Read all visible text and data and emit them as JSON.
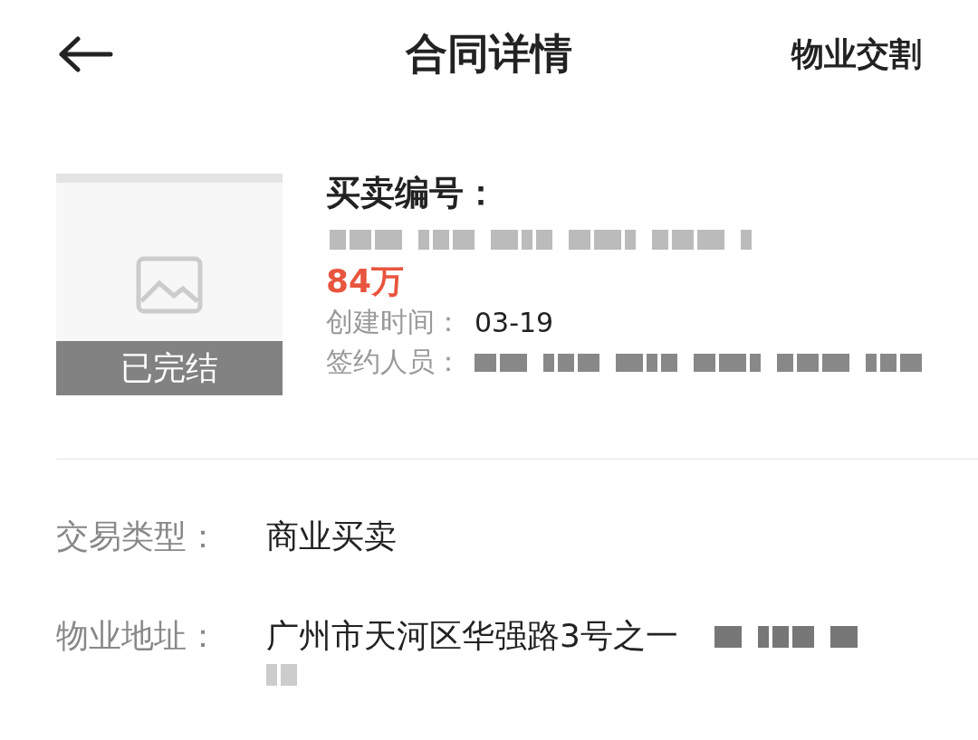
{
  "header": {
    "title": "合同详情",
    "action": "物业交割"
  },
  "contract": {
    "status": "已完结",
    "number_label": "买卖编号：",
    "number_redacted": true,
    "price": "84万",
    "fields": [
      {
        "label": "创建时间：",
        "value": "03-19"
      },
      {
        "label": "签约人员：",
        "redacted": true
      }
    ]
  },
  "details": [
    {
      "label": "交易类型：",
      "value": "商业买卖"
    },
    {
      "label": "物业地址：",
      "value": "广州市天河区华强路3号之一",
      "redacted": true
    }
  ]
}
